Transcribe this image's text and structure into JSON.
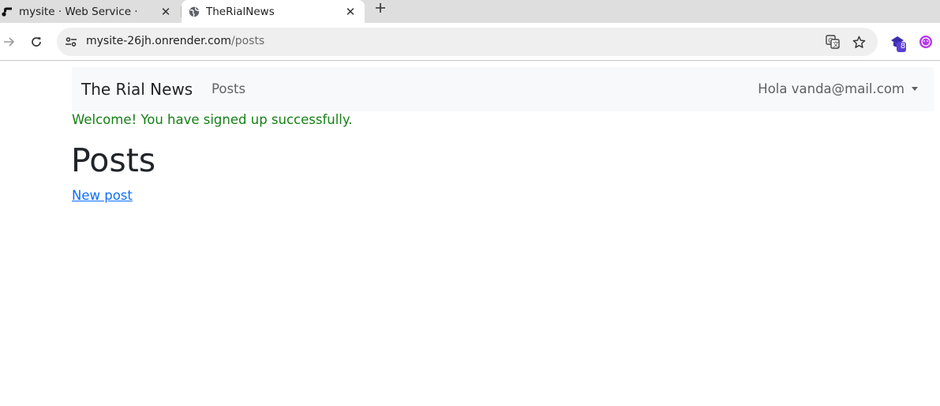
{
  "tabs": [
    {
      "title": "mysite · Web Service ·",
      "favicon": "render-icon",
      "active": false
    },
    {
      "title": "TheRialNews",
      "favicon": "globe-icon",
      "active": true
    }
  ],
  "toolbar": {
    "url_host": "mysite-26jh.onrender.com",
    "url_path": "/posts",
    "extension_badge": "8"
  },
  "navbar": {
    "brand": "The Rial News",
    "posts_link": "Posts",
    "user_menu": "Hola vanda@mail.com"
  },
  "page": {
    "notice": "Welcome! You have signed up successfully.",
    "title": "Posts",
    "new_post_link": "New post"
  },
  "colors": {
    "notice": "#158015",
    "link": "#0d6efd",
    "navbar_bg": "#f8f9fa"
  }
}
